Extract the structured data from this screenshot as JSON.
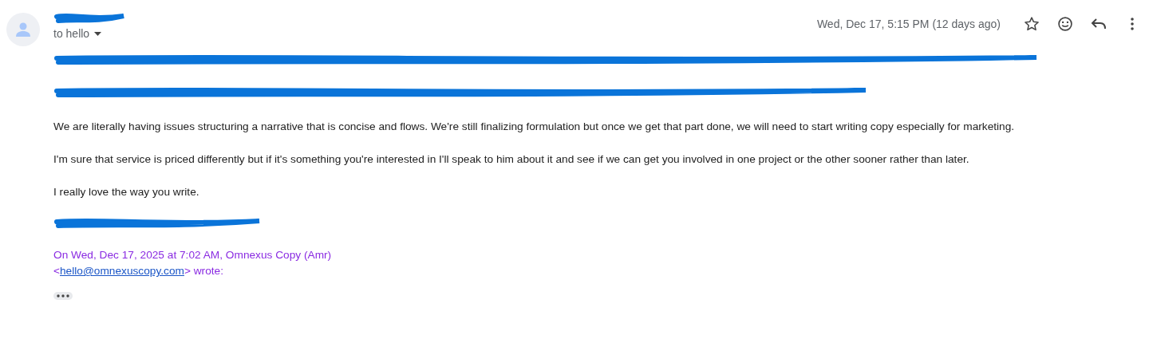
{
  "header": {
    "sender": {
      "kind": "redacted"
    },
    "recipient": "to hello",
    "date": "Wed, Dec 17, 5:15 PM (12 days ago)"
  },
  "body": [
    {
      "kind": "redacted"
    },
    {
      "kind": "redacted"
    },
    {
      "kind": "text",
      "text": "We are literally having issues structuring a narrative that is concise and flows. We're still finalizing formulation but once we get that part done, we will need to start writing copy especially for marketing."
    },
    {
      "kind": "text",
      "text": "I'm sure that service is priced differently but if it's something you're interested in I'll speak to him about it and see if we can get you involved in one project or the other sooner rather than later."
    },
    {
      "kind": "text",
      "text": "I really love the way you write."
    },
    {
      "kind": "redacted"
    }
  ],
  "quote": {
    "attribution": "On Wed, Dec 17, 2025 at 7:02 AM, Omnexus Copy (Amr)",
    "open": "<",
    "email": "hello@omnexuscopy.com",
    "close": "> wrote:"
  }
}
